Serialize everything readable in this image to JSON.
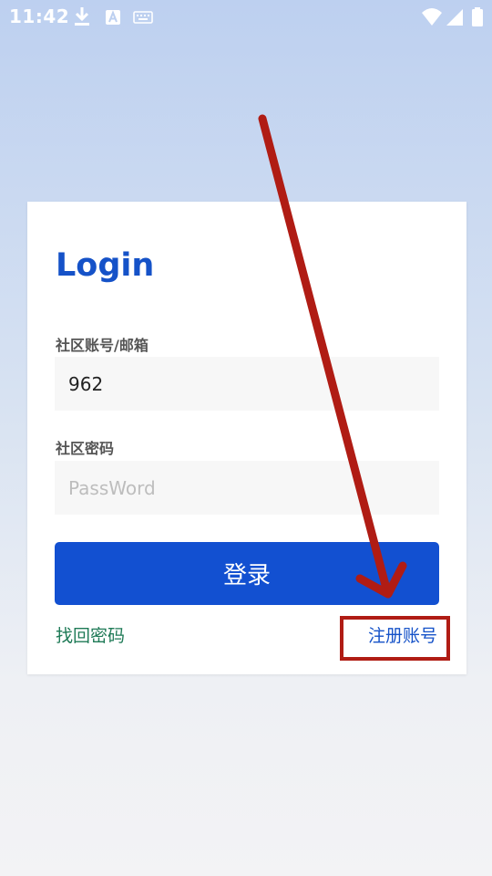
{
  "status_bar": {
    "time": "11:42",
    "icons": [
      "download-icon",
      "a-text-icon",
      "keyboard-icon",
      "wifi-icon",
      "signal-icon",
      "battery-icon"
    ]
  },
  "login": {
    "title": "Login",
    "account_label": "社区账号/邮箱",
    "account_value": "962",
    "password_label": "社区密码",
    "password_placeholder": "PassWord",
    "login_button": "登录",
    "forgot_link": "找回密码",
    "register_link": "注册账号"
  },
  "colors": {
    "accent": "#1250d1",
    "forgot_link": "#1e7a56",
    "annotation": "#b01c14"
  }
}
